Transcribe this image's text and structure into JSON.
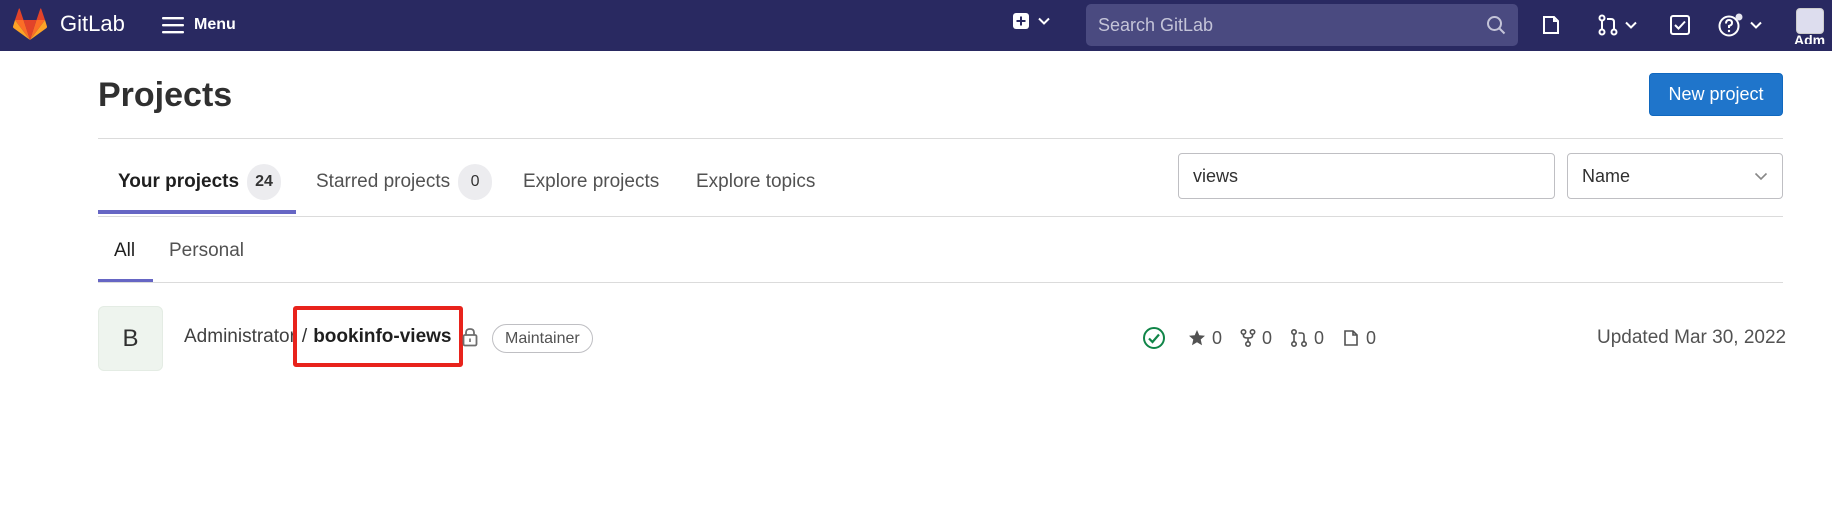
{
  "header": {
    "brand": "GitLab",
    "menu_label": "Menu",
    "search_placeholder": "Search GitLab",
    "user_label": "Adm"
  },
  "page": {
    "title": "Projects",
    "new_project_label": "New project"
  },
  "tabs": [
    {
      "label": "Your projects",
      "count": "24",
      "active": true
    },
    {
      "label": "Starred projects",
      "count": "0",
      "active": false
    },
    {
      "label": "Explore projects",
      "active": false
    },
    {
      "label": "Explore topics",
      "active": false
    }
  ],
  "filter": {
    "value": "views",
    "sort_value": "Name"
  },
  "subtabs": [
    {
      "label": "All",
      "active": true
    },
    {
      "label": "Personal",
      "active": false
    }
  ],
  "projects": [
    {
      "avatar_letter": "B",
      "namespace": "Administrator",
      "separator": "/",
      "name": "bookinfo-views",
      "role": "Maintainer",
      "pipeline_status": "success",
      "stars": "0",
      "forks": "0",
      "merge_requests": "0",
      "issues": "0",
      "updated_prefix": "Updated",
      "updated_date": "Mar 30, 2022"
    }
  ],
  "colors": {
    "topbar": "#292961",
    "primary": "#1f75cb",
    "tab_active": "#6666c4",
    "highlight_box": "#e8231c",
    "success": "#108548"
  }
}
